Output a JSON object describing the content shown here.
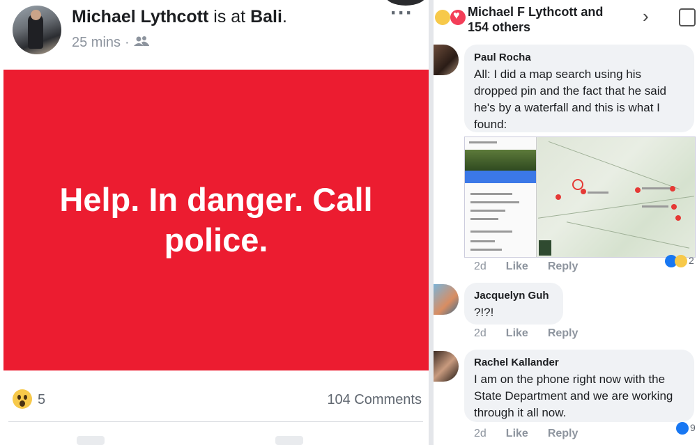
{
  "post": {
    "author_name": "Michael Lythcott",
    "author_connector": " is at ",
    "location": "Bali",
    "location_suffix": ".",
    "timestamp": "25 mins",
    "meta_separator": "·",
    "audience_icon": "friends-icon",
    "more_label": "···",
    "message": "Help. In danger. Call police.",
    "message_bg": "#ec1c30",
    "reactions_count": "5",
    "reaction_icon": "wow-icon",
    "comments_label": "104 Comments"
  },
  "comments_panel": {
    "header_title": "Michael F Lythcott and 154 others",
    "header_icons": [
      "wow-icon",
      "love-icon"
    ],
    "chevron_icon": "chevron-right-icon",
    "like_icon": "thumbs-up-icon",
    "comments": [
      {
        "name": "Paul Rocha",
        "text": "All: I did a map search using his dropped pin and the fact that he said he's by a waterfall and this is what I found:",
        "time": "2d",
        "like": "Like",
        "reply": "Reply",
        "reaction_count": "2"
      },
      {
        "name": "Jacquelyn Guh",
        "text": "?!?!",
        "time": "2d",
        "like": "Like",
        "reply": "Reply"
      },
      {
        "name": "Rachel Kallander",
        "text": "I am on the phone right now with the State Department and we are working through it all now.",
        "time": "2d",
        "like": "Like",
        "reply": "Reply",
        "reaction_count": "9"
      }
    ]
  },
  "colors": {
    "facebook_blue": "#1877f2",
    "wow_yellow": "#f7c94a",
    "love_red": "#f33e58",
    "meta_gray": "#8d949e"
  }
}
